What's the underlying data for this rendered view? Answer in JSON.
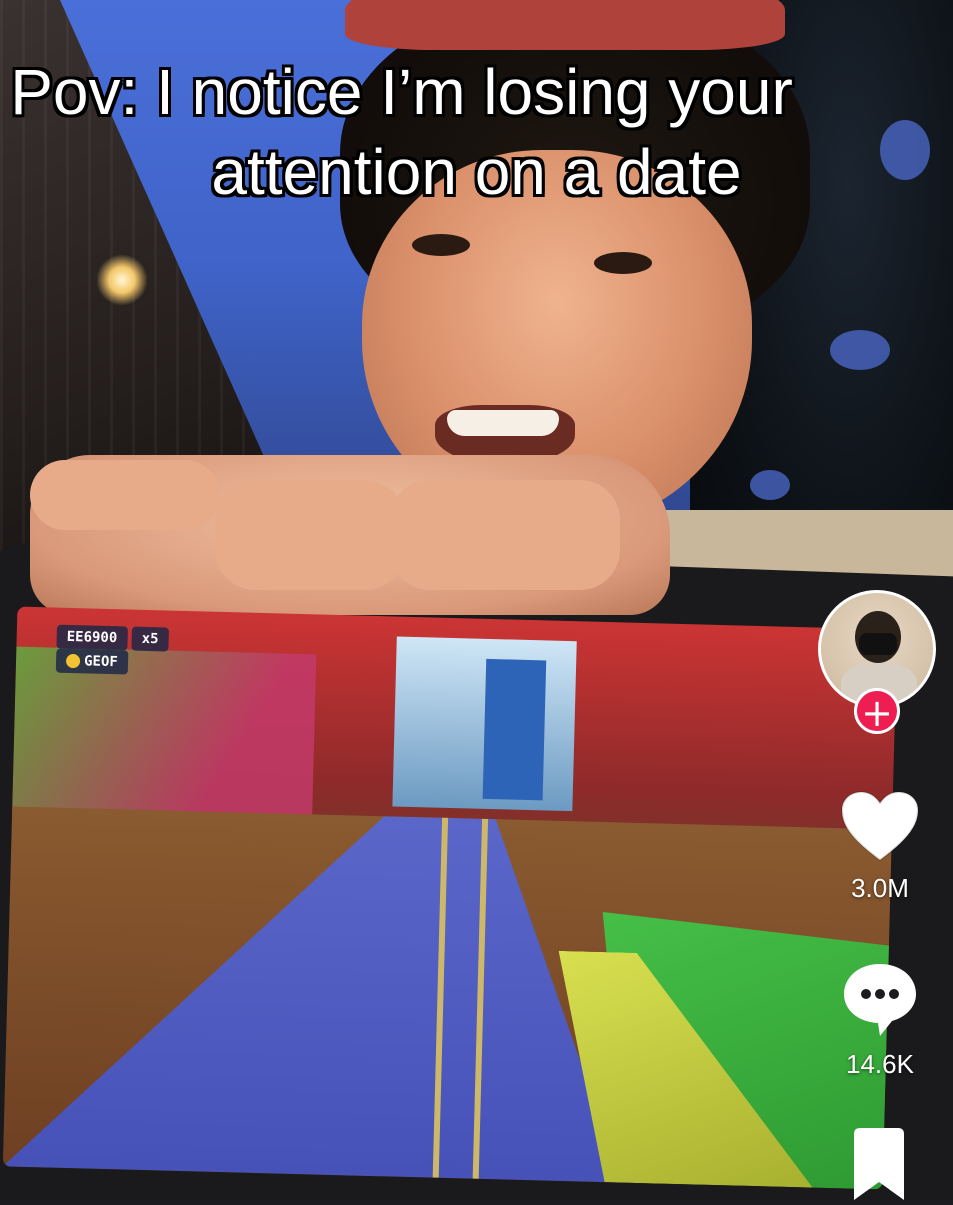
{
  "video": {
    "caption_line1": "Pov: I notice I’m losing your",
    "caption_line2": "attention on a date"
  },
  "game_hud": {
    "score": "EE6900",
    "multiplier": "x5",
    "coins": "GEOF"
  },
  "sidebar": {
    "follow_label": "+",
    "likes_count": "3.0M",
    "comments_count": "14.6K",
    "icons": {
      "like": "heart-icon",
      "comment": "comment-bubble-icon",
      "save": "bookmark-icon",
      "follow": "plus-icon"
    }
  },
  "colors": {
    "follow_accent": "#ee1d52",
    "icon_color": "#ffffff"
  }
}
